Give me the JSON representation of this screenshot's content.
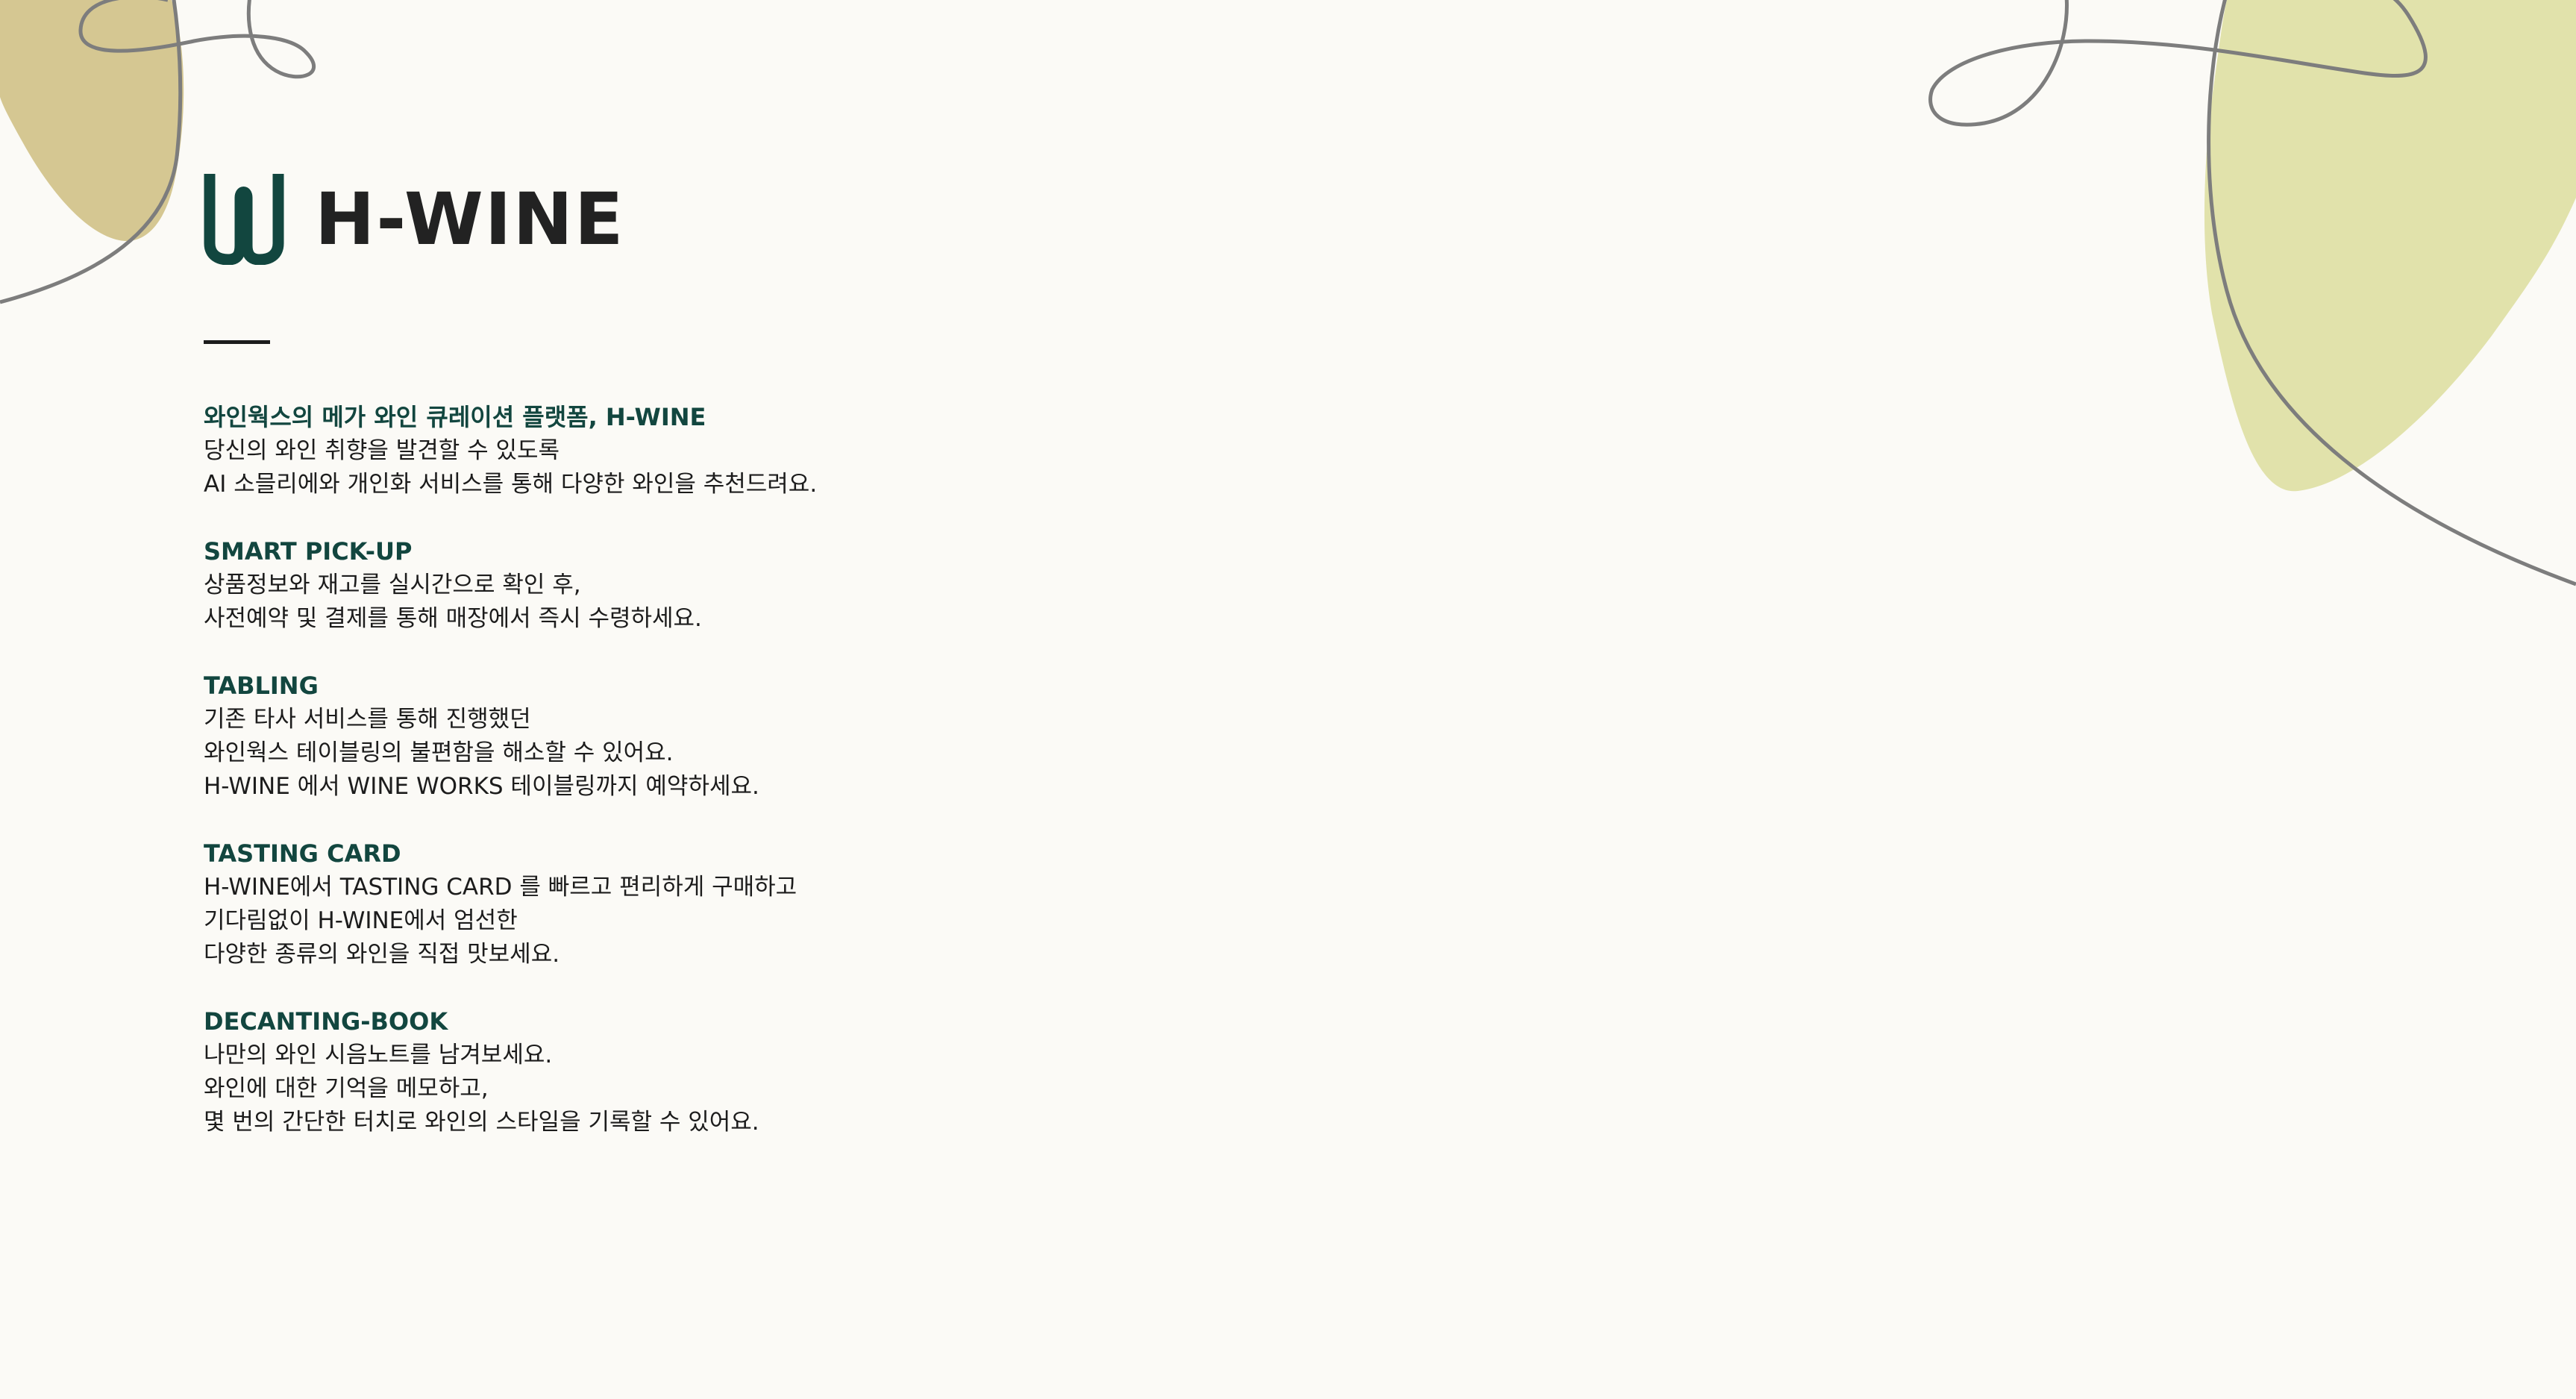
{
  "brand": {
    "name": "H-WINE",
    "logo_icon": "h-wine-w-logo-icon"
  },
  "colors": {
    "background": "#fbfaf6",
    "accent": "#12463f",
    "text": "#1c1c1c",
    "blob_left": "#d5c792",
    "blob_right": "#e1e2ab",
    "line": "#7d7d7d"
  },
  "sections": [
    {
      "title": "와인웍스의 메가 와인 큐레이션 플랫폼, H-WINE",
      "lines": [
        "당신의 와인 취향을 발견할 수 있도록",
        "AI 소믈리에와 개인화 서비스를 통해 다양한 와인을 추천드려요."
      ]
    },
    {
      "title": "SMART PICK-UP",
      "lines": [
        "상품정보와 재고를 실시간으로 확인 후,",
        "사전예약 및 결제를 통해 매장에서 즉시 수령하세요."
      ]
    },
    {
      "title": "TABLING",
      "lines": [
        "기존 타사 서비스를 통해 진행했던",
        "와인웍스 테이블링의 불편함을 해소할 수 있어요.",
        "H-WINE 에서 WINE WORKS 테이블링까지 예약하세요."
      ]
    },
    {
      "title": "TASTING CARD",
      "lines": [
        "H-WINE에서 TASTING CARD 를 빠르고 편리하게 구매하고",
        "기다림없이 H-WINE에서 엄선한",
        "다양한 종류의 와인을 직접 맛보세요."
      ]
    },
    {
      "title": "DECANTING-BOOK",
      "lines": [
        "나만의 와인 시음노트를 남겨보세요.",
        "와인에 대한 기억을 메모하고,",
        "몇 번의 간단한 터치로 와인의 스타일을 기록할 수 있어요."
      ]
    }
  ]
}
